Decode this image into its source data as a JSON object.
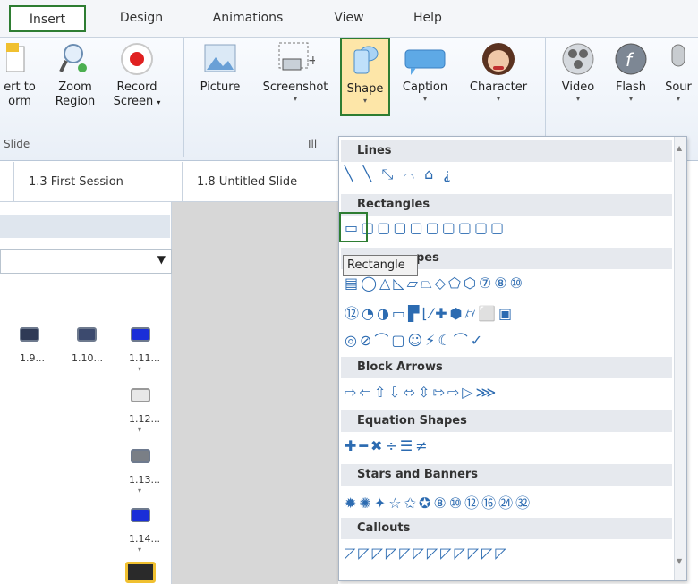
{
  "tabs": [
    "Insert",
    "Design",
    "Animations",
    "View",
    "Help"
  ],
  "ribbon": {
    "slide_group": {
      "label": "Slide",
      "buttons": [
        {
          "label1": "ert to",
          "label2": "orm"
        },
        {
          "label1": "Zoom",
          "label2": "Region"
        },
        {
          "label1": "Record",
          "label2": "Screen"
        }
      ]
    },
    "illus_group": {
      "label": "Ill",
      "buttons": [
        "Picture",
        "Screenshot",
        "Shape",
        "Caption",
        "Character"
      ]
    },
    "media_group": {
      "buttons": [
        "Video",
        "Flash",
        "Sour"
      ]
    }
  },
  "slide_tabs": [
    "1.3 First Session",
    "1.8 Untitled Slide"
  ],
  "thumbnails": [
    "1.9...",
    "1.10...",
    "1.11...",
    "1.12...",
    "1.13...",
    "1.14..."
  ],
  "dropdown": {
    "sections": [
      "Lines",
      "Rectangles",
      "pes",
      "Block Arrows",
      "Equation Shapes",
      "Stars and Banners",
      "Callouts"
    ],
    "rows": {
      "lines": "╲ ╲ ⤡ ⌒ ⌂ ⸘",
      "rectangles": "▭▢▢▢▢▢▢▢▢▢",
      "basic1": "▤◯△◺▱⏢◇⬠⬡⑦⑧⑩",
      "basic2": "⑫◔◑▭▛⌊⁄✚⬢⌭⬜▣",
      "basic3": "◎⊘⌒▢☺⚡☾⌒✓",
      "arrows": "⇨⇦⇧⇩⬄⇳⇰⇨▷⋙",
      "equation": "✚━✖÷☰≠",
      "stars": "✹✺✦☆✩✪⑧⑩⑫⑯㉔㉜",
      "callouts": "◸◸◸◸◸◸◸◸◸◸◸◸"
    },
    "tooltip": "Rectangle"
  },
  "colors": {
    "highlight": "#2e7d32",
    "shape_icon": "#2c6bb1"
  }
}
